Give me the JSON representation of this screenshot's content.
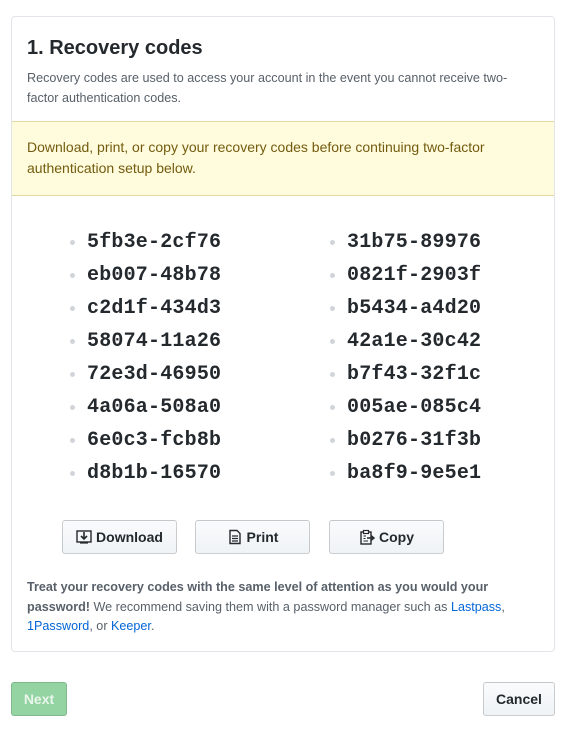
{
  "section": {
    "title": "1. Recovery codes",
    "description": "Recovery codes are used to access your account in the event you cannot receive two-factor authentication codes."
  },
  "flash": {
    "text": "Download, print, or copy your recovery codes before continuing two-factor authentication setup below."
  },
  "codes": {
    "left": [
      "5fb3e-2cf76",
      "eb007-48b78",
      "c2d1f-434d3",
      "58074-11a26",
      "72e3d-46950",
      "4a06a-508a0",
      "6e0c3-fcb8b",
      "d8b1b-16570"
    ],
    "right": [
      "31b75-89976",
      "0821f-2903f",
      "b5434-a4d20",
      "42a1e-30c42",
      "b7f43-32f1c",
      "005ae-085c4",
      "b0276-31f3b",
      "ba8f9-9e5e1"
    ]
  },
  "actions": {
    "download_label": "Download",
    "download_icon": "download-icon",
    "print_label": "Print",
    "print_icon": "file-icon",
    "copy_label": "Copy",
    "copy_icon": "clipboard-icon"
  },
  "note": {
    "strong": "Treat your recovery codes with the same level of attention as you would your password!",
    "text": " We recommend saving them with a password manager such as ",
    "link1": "Lastpass",
    "sep1": ", ",
    "link2": "1Password",
    "sep2": ", or ",
    "link3": "Keeper",
    "end": "."
  },
  "footer": {
    "next_label": "Next",
    "cancel_label": "Cancel"
  },
  "colors": {
    "flash_bg": "#fffbdd",
    "flash_text": "#735c0f",
    "link": "#0366d6",
    "next_disabled": "#94d3a2"
  }
}
